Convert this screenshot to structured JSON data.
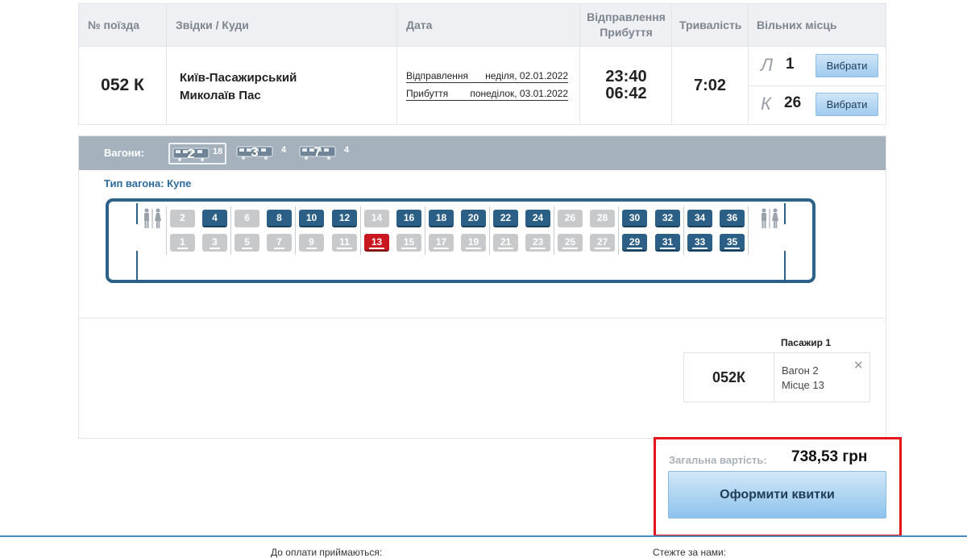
{
  "table": {
    "headers": {
      "train_no": "№ поїзда",
      "route": "Звідки / Куди",
      "date": "Дата",
      "dep_line": "Відправлення",
      "arr_line": "Прибуття",
      "duration": "Тривалість",
      "free_seats": "Вільних місць"
    },
    "train": {
      "number": "052 К",
      "from": "Київ-Пасажирський",
      "to": "Миколаїв Пас",
      "dep_label": "Відправлення",
      "dep_date": "неділя, 02.01.2022",
      "arr_label": "Прибуття",
      "arr_date": "понеділок, 03.01.2022",
      "dep_time": "23:40",
      "arr_time": "06:42",
      "duration": "7:02"
    },
    "seat_classes": [
      {
        "class": "Л",
        "count": "1",
        "button": "Вибрати"
      },
      {
        "class": "К",
        "count": "26",
        "button": "Вибрати"
      }
    ]
  },
  "wagons": {
    "label": "Вагони:",
    "tabs": [
      {
        "number": "2",
        "free": "18",
        "selected": true
      },
      {
        "number": "3",
        "free": "4",
        "selected": false
      },
      {
        "number": "7",
        "free": "4",
        "selected": false
      }
    ],
    "type_label": "Тип вагона: Купе",
    "upper_seats": [
      {
        "n": "2",
        "s": "occ"
      },
      {
        "n": "4",
        "s": "avail"
      },
      {
        "n": "6",
        "s": "occ"
      },
      {
        "n": "8",
        "s": "avail"
      },
      {
        "n": "10",
        "s": "avail"
      },
      {
        "n": "12",
        "s": "avail"
      },
      {
        "n": "14",
        "s": "occ"
      },
      {
        "n": "16",
        "s": "avail"
      },
      {
        "n": "18",
        "s": "avail"
      },
      {
        "n": "20",
        "s": "avail"
      },
      {
        "n": "22",
        "s": "avail"
      },
      {
        "n": "24",
        "s": "avail"
      },
      {
        "n": "26",
        "s": "occ"
      },
      {
        "n": "28",
        "s": "occ"
      },
      {
        "n": "30",
        "s": "avail"
      },
      {
        "n": "32",
        "s": "avail"
      },
      {
        "n": "34",
        "s": "avail"
      },
      {
        "n": "36",
        "s": "avail"
      }
    ],
    "lower_seats": [
      {
        "n": "1",
        "s": "occ"
      },
      {
        "n": "3",
        "s": "occ"
      },
      {
        "n": "5",
        "s": "occ"
      },
      {
        "n": "7",
        "s": "occ"
      },
      {
        "n": "9",
        "s": "occ"
      },
      {
        "n": "11",
        "s": "occ"
      },
      {
        "n": "13",
        "s": "sel"
      },
      {
        "n": "15",
        "s": "occ"
      },
      {
        "n": "17",
        "s": "occ"
      },
      {
        "n": "19",
        "s": "occ"
      },
      {
        "n": "21",
        "s": "occ"
      },
      {
        "n": "23",
        "s": "occ"
      },
      {
        "n": "25",
        "s": "occ"
      },
      {
        "n": "27",
        "s": "occ"
      },
      {
        "n": "29",
        "s": "avail"
      },
      {
        "n": "31",
        "s": "avail"
      },
      {
        "n": "33",
        "s": "avail"
      },
      {
        "n": "35",
        "s": "avail"
      }
    ],
    "icons": [
      "wagon-icon",
      "toilet-icon"
    ]
  },
  "passenger": {
    "label": "Пасажир 1",
    "train": "052К",
    "wagon": "Вагон 2",
    "seat": "Місце 13"
  },
  "total": {
    "label": "Загальна вартість:",
    "value": "738,53 грн",
    "order_button": "Оформити квитки"
  },
  "footer": {
    "payment": "До оплати приймаються:",
    "follow": "Стежте за нами:"
  },
  "colors": {
    "seat_available": "#2b5f86",
    "seat_occupied": "#c7c9cb",
    "seat_selected": "#c8171e",
    "highlight": "#e8141c"
  }
}
